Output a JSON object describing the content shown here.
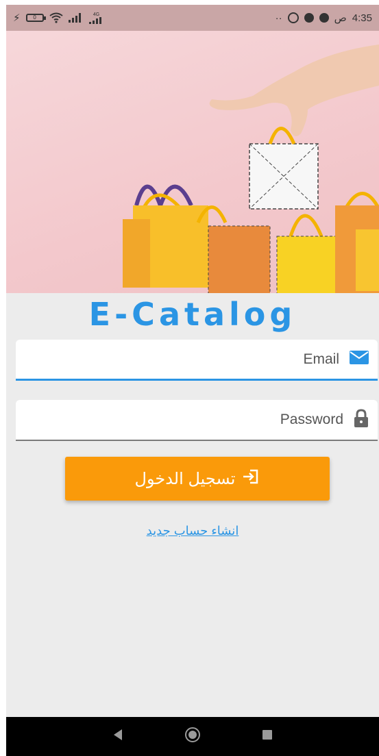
{
  "status_bar": {
    "time": "4:35",
    "am_pm": "ص",
    "network_label": "4G",
    "battery_level": "0"
  },
  "app": {
    "title": "E-Catalog"
  },
  "form": {
    "email_placeholder": "Email",
    "password_placeholder": "Password",
    "login_button_label": "تسجيل الدخول",
    "register_link_label": "انشاء حساب جديد"
  },
  "icons": {
    "email": "envelope-icon",
    "password": "lock-icon",
    "login": "sign-in-icon"
  },
  "colors": {
    "accent": "#2b95e4",
    "button": "#fa9a0a"
  }
}
